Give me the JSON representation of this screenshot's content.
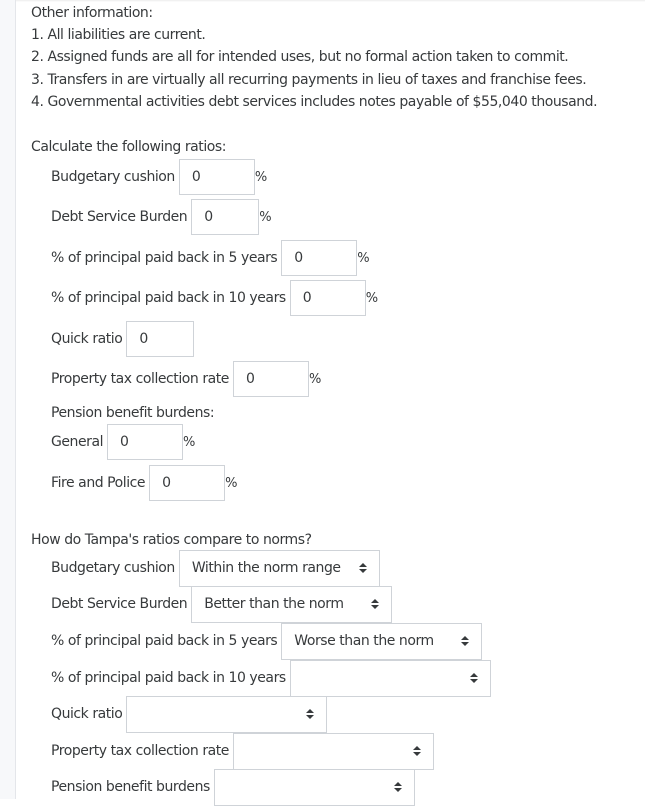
{
  "other_info": {
    "heading": "Other information:",
    "items": [
      "1. All liabilities are current.",
      "2. Assigned funds are all for intended uses, but no formal action taken to commit.",
      "3. Transfers in are virtually all recurring payments in lieu of taxes and franchise fees.",
      "4. Governmental activities debt services includes notes payable of $55,040 thousand."
    ]
  },
  "calculate": {
    "heading": "Calculate the following ratios:",
    "fields": {
      "budgetary_cushion": {
        "label": "Budgetary cushion",
        "value": "0",
        "unit": "%"
      },
      "debt_service_burden": {
        "label": "Debt Service Burden",
        "value": "0",
        "unit": "%"
      },
      "principal_5yr": {
        "label": "% of principal paid back in 5 years",
        "value": "0",
        "unit": "%"
      },
      "principal_10yr": {
        "label": "% of principal paid back in 10 years",
        "value": "0",
        "unit": "%"
      },
      "quick_ratio": {
        "label": "Quick ratio",
        "value": "0"
      },
      "property_tax": {
        "label": "Property tax collection rate",
        "value": "0",
        "unit": "%"
      }
    },
    "pension_heading": "Pension benefit burdens:",
    "pension": {
      "general": {
        "label": "General",
        "value": "0",
        "unit": "%"
      },
      "fire_police": {
        "label": "Fire and Police",
        "value": "0",
        "unit": "%"
      }
    }
  },
  "compare": {
    "heading": "How do Tampa's ratios compare to norms?",
    "selects": {
      "budgetary_cushion": {
        "label": "Budgetary cushion",
        "selected": "Within the norm range"
      },
      "debt_service_burden": {
        "label": "Debt Service Burden",
        "selected": "Better than the norm"
      },
      "principal_5yr": {
        "label": "% of principal paid back in 5 years",
        "selected": "Worse than the norm"
      },
      "principal_10yr": {
        "label": "% of principal paid back in 10 years",
        "selected": ""
      },
      "quick_ratio": {
        "label": "Quick ratio",
        "selected": ""
      },
      "property_tax": {
        "label": "Property tax collection rate",
        "selected": ""
      },
      "pension": {
        "label": "Pension benefit burdens",
        "selected": ""
      }
    }
  }
}
